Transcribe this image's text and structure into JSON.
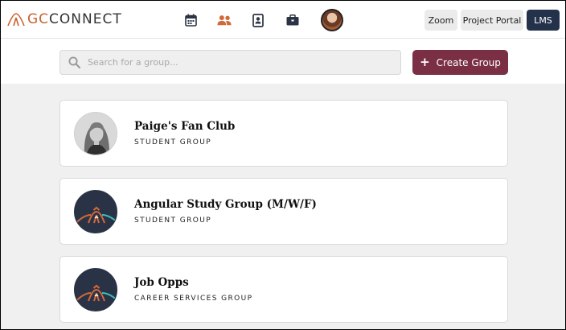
{
  "header": {
    "logo_prefix": "GC",
    "logo_suffix": "CONNECT",
    "buttons": {
      "zoom": "Zoom",
      "project_portal": "Project Portal",
      "lms": "LMS"
    },
    "icons": [
      "calendar-icon",
      "people-icon",
      "contact-book-icon",
      "briefcase-icon"
    ]
  },
  "search": {
    "placeholder": "Search for a group..."
  },
  "create_group": {
    "plus": "+",
    "label": "Create Group"
  },
  "groups": [
    {
      "name": "Paige's Fan Club",
      "type": "STUDENT GROUP",
      "avatar": "photo"
    },
    {
      "name": "Angular Study Group (M/W/F)",
      "type": "STUDENT GROUP",
      "avatar": "gc-logo"
    },
    {
      "name": "Job Opps",
      "type": "CAREER SERVICES GROUP",
      "avatar": "gc-logo"
    }
  ],
  "colors": {
    "brand_orange": "#c9622f",
    "create_button": "#7a2f45",
    "lms_button": "#23324a",
    "page_bg": "#f0f0f0"
  }
}
